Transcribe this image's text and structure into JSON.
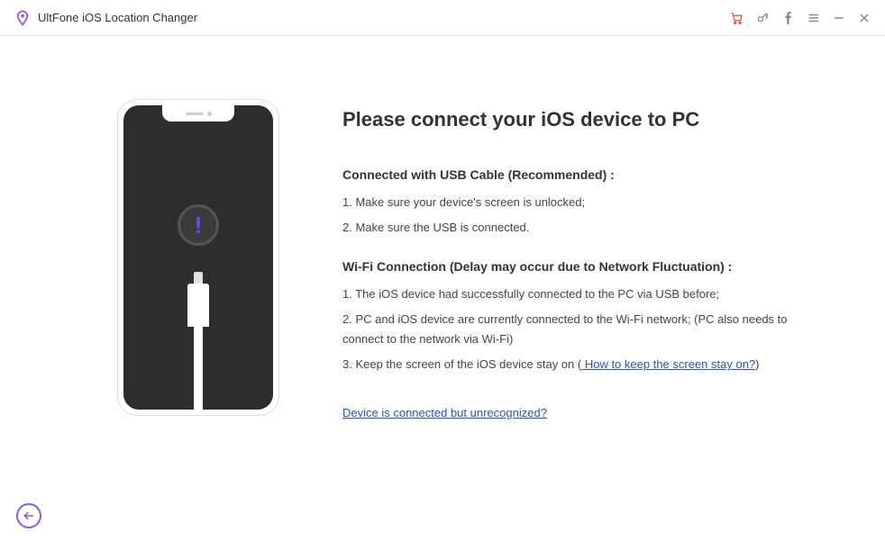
{
  "app": {
    "title": "UltFone iOS Location Changer"
  },
  "main": {
    "heading": "Please connect your iOS device to PC",
    "usb": {
      "title": "Connected with USB Cable (Recommended) :",
      "step1": "1. Make sure your device's screen is unlocked;",
      "step2": "2. Make sure the USB is connected."
    },
    "wifi": {
      "title": "Wi-Fi Connection (Delay may occur due to Network Fluctuation) :",
      "step1": "1. The iOS device had successfully connected to the PC via USB before;",
      "step2": "2. PC and iOS device are currently connected to the Wi-Fi network; (PC also needs to connect to the network via Wi-Fi)",
      "step3_prefix": "3. Keep the screen of the iOS device stay on  (",
      "step3_link": " How to keep the screen stay on?",
      "step3_suffix": ")"
    },
    "unrecognized_link": "Device is connected but unrecognized?"
  }
}
